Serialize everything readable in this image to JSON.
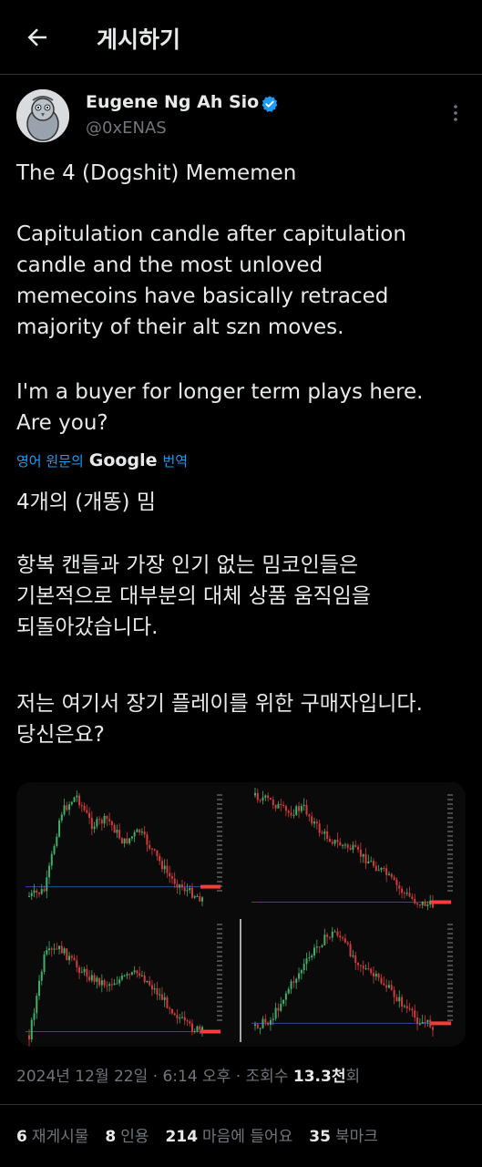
{
  "header": {
    "title": "게시하기"
  },
  "author": {
    "name": "Eugene Ng Ah Sio",
    "handle": "@0xENAS"
  },
  "post": {
    "line1": "The 4 (Dogshit) Mememen",
    "para2": "Capitulation candle after capitulation\ncandle and the most unloved\nmemecoins have basically retraced\nmajority of their alt szn moves.",
    "para3": "I'm a buyer for longer term plays here.\nAre you?"
  },
  "translate": {
    "prefix": "영어 원문의",
    "brand": "Google",
    "suffix": "번역"
  },
  "translation": {
    "line1": "4개의 (개똥) 밈",
    "para2": "항복 캔들과 가장 인기 없는 밈코인들은\n기본적으로 대부분의 대체 상품 움직임을\n되돌아갔습니다.",
    "para3": "저는 여기서 장기 플레이를 위한 구매자입니다.\n당신은요?"
  },
  "meta": {
    "date": "2024년 12월 22일 · 6:14 오후 · 조회수 ",
    "views": "13.3천",
    "views_suffix": "회"
  },
  "stats": {
    "reposts_num": "6",
    "reposts_label": "재게시물",
    "quotes_num": "8",
    "quotes_label": "인용",
    "likes_num": "214",
    "likes_label": "마음에 들어요",
    "bookmarks_num": "35",
    "bookmarks_label": "북마크"
  },
  "colors": {
    "accent": "#1d9bf0",
    "candle_up": "#3fae6a",
    "candle_down": "#d23b3b",
    "marker": "#ff3b3b"
  }
}
